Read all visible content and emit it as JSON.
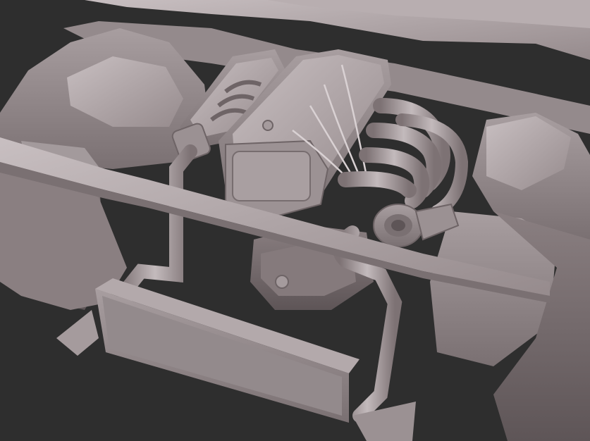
{
  "scene": {
    "subject": "3d-engine-bay-render",
    "background_color": "#2e2e2e",
    "model_color": "#8e8385"
  }
}
